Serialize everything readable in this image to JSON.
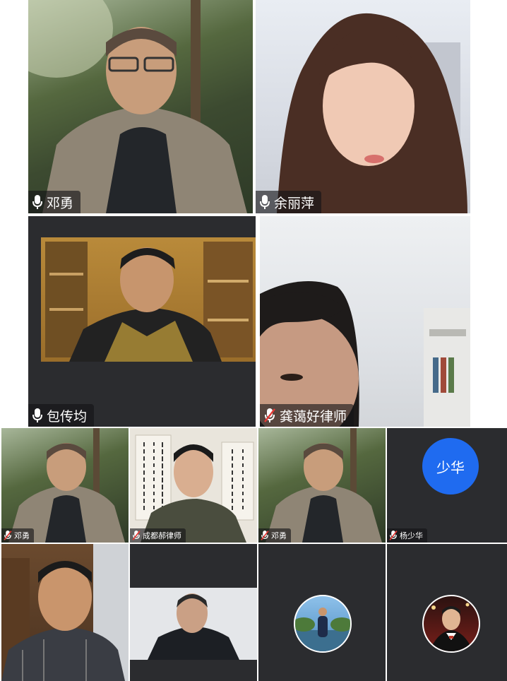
{
  "participants": {
    "deng_yong_large": {
      "name": "邓勇",
      "mic": "mic-icon"
    },
    "yu_liping": {
      "name": "余丽萍",
      "mic": "mic-icon"
    },
    "bao_chuanjun": {
      "name": "包传均",
      "mic": "mic-icon"
    },
    "gong_aihao": {
      "name": "龚蔼好律师",
      "mic": "mic-muted-icon"
    },
    "deng_yong_small_1": {
      "name": "邓勇",
      "mic": "mic-muted-icon"
    },
    "chengdu_hao": {
      "name": "成都郝律师",
      "mic": "mic-muted-icon"
    },
    "deng_yong_small_2": {
      "name": "邓勇",
      "mic": "mic-muted-icon"
    },
    "yang_shaohua": {
      "name": "杨少华",
      "avatar_text": "少华",
      "mic": "mic-muted-icon"
    }
  },
  "colors": {
    "tile_bg": "#2b2c2f",
    "avatar_blue": "#1f6bf0",
    "label_bg": "rgba(20,20,22,0.62)",
    "mute_red": "#e53935"
  }
}
